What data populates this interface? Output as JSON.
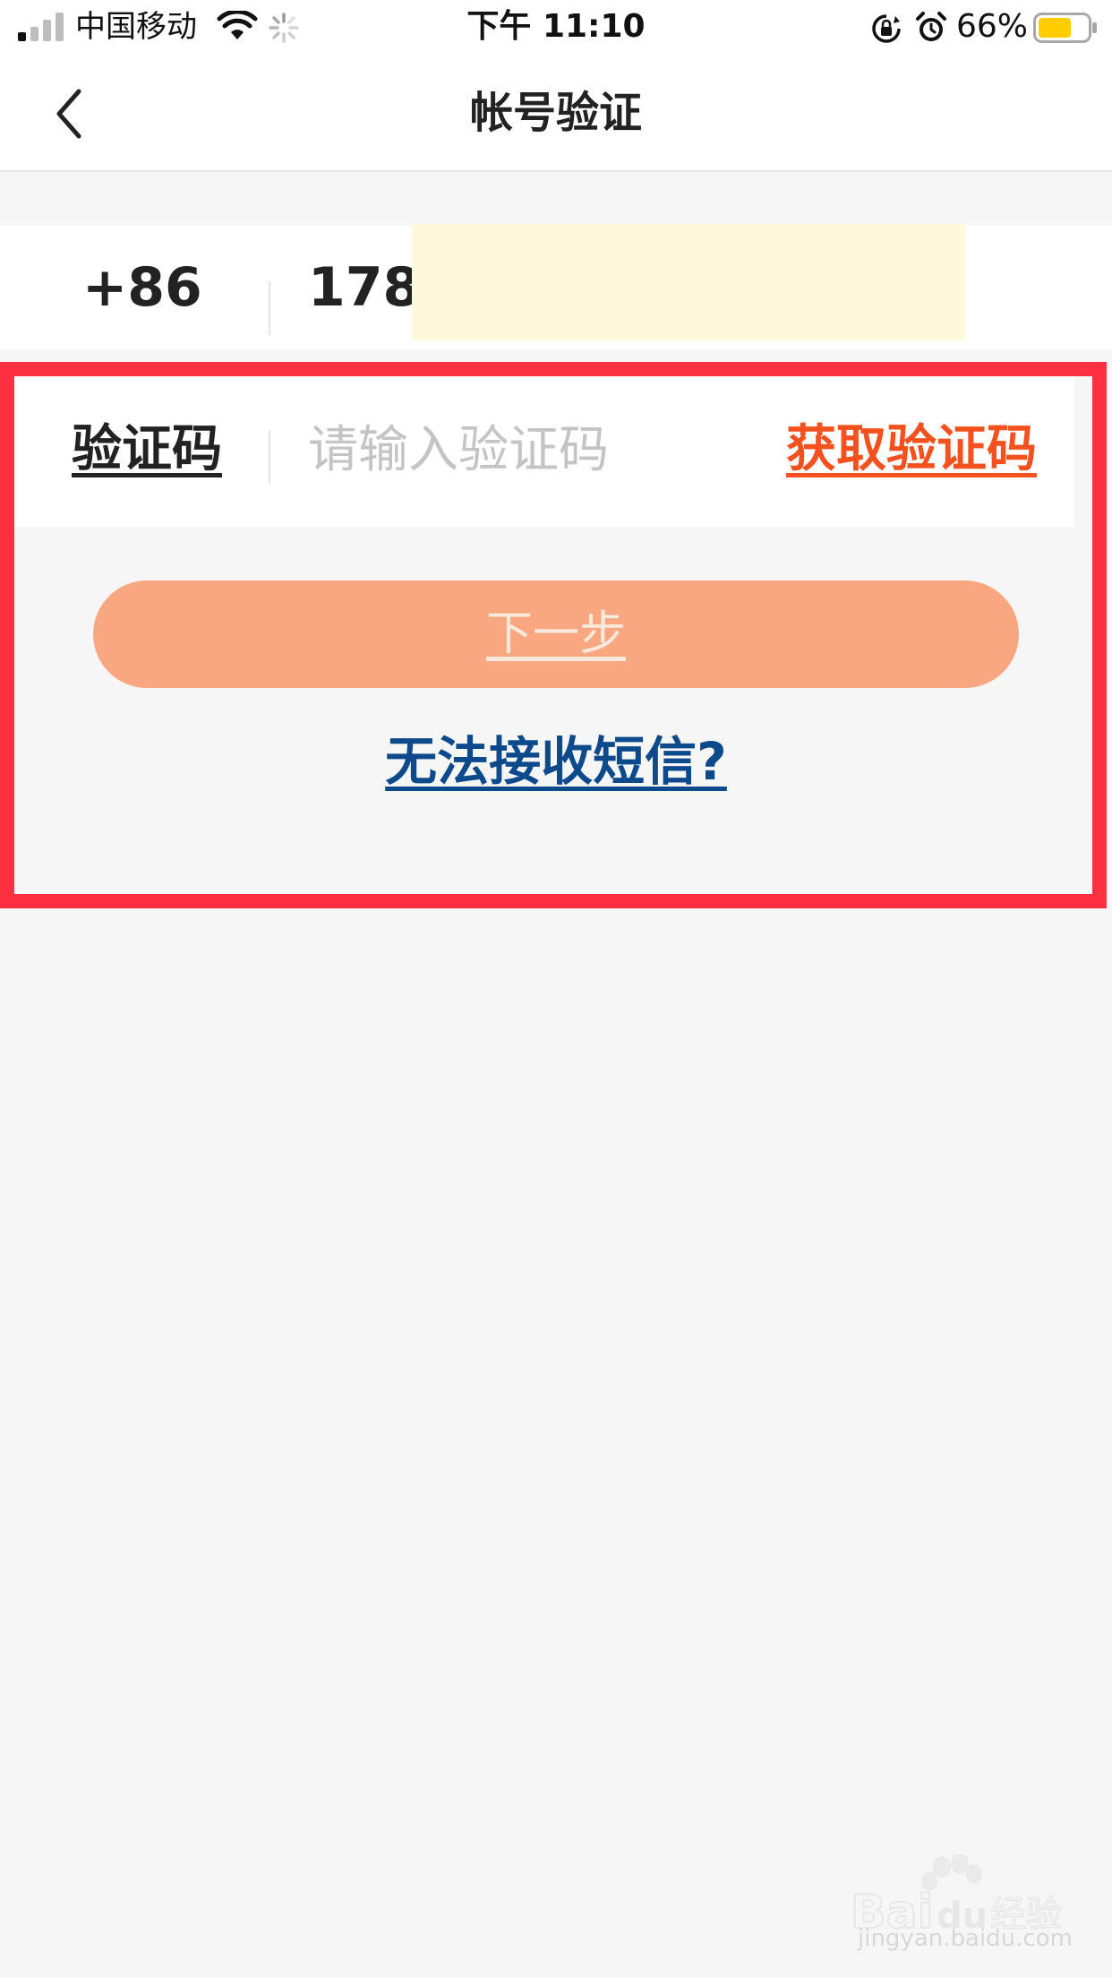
{
  "status_bar": {
    "carrier": "中国移动",
    "time": "下午 11:10",
    "battery_percent": "66%",
    "battery_level": 0.66,
    "signal_bars_filled": 1,
    "signal_bars_total": 4,
    "icons": [
      "signal-icon",
      "wifi-icon",
      "loading-spinner-icon",
      "rotation-lock-icon",
      "alarm-icon",
      "battery-icon"
    ]
  },
  "nav": {
    "title": "帐号验证",
    "back_icon": "chevron-left-icon"
  },
  "phone": {
    "country_code": "+86",
    "number_visible": "178*"
  },
  "code": {
    "label": "验证码",
    "placeholder": "请输入验证码",
    "value": "",
    "get_code_label": "获取验证码"
  },
  "next_button": {
    "label": "下一步",
    "enabled": false
  },
  "links": {
    "cannot_receive_sms": "无法接收短信?"
  },
  "watermark": {
    "brand": "Baidu经验",
    "url": "jingyan.baidu.com"
  },
  "colors": {
    "page_background": "#f6f6f6",
    "highlight_frame": "#fd3042",
    "accent_orange": "#f4511e",
    "next_button_disabled": "#f9a781",
    "link_blue": "#0d4a8c",
    "redaction": "#fdf9dd",
    "battery_fill": "#ffcc00"
  }
}
